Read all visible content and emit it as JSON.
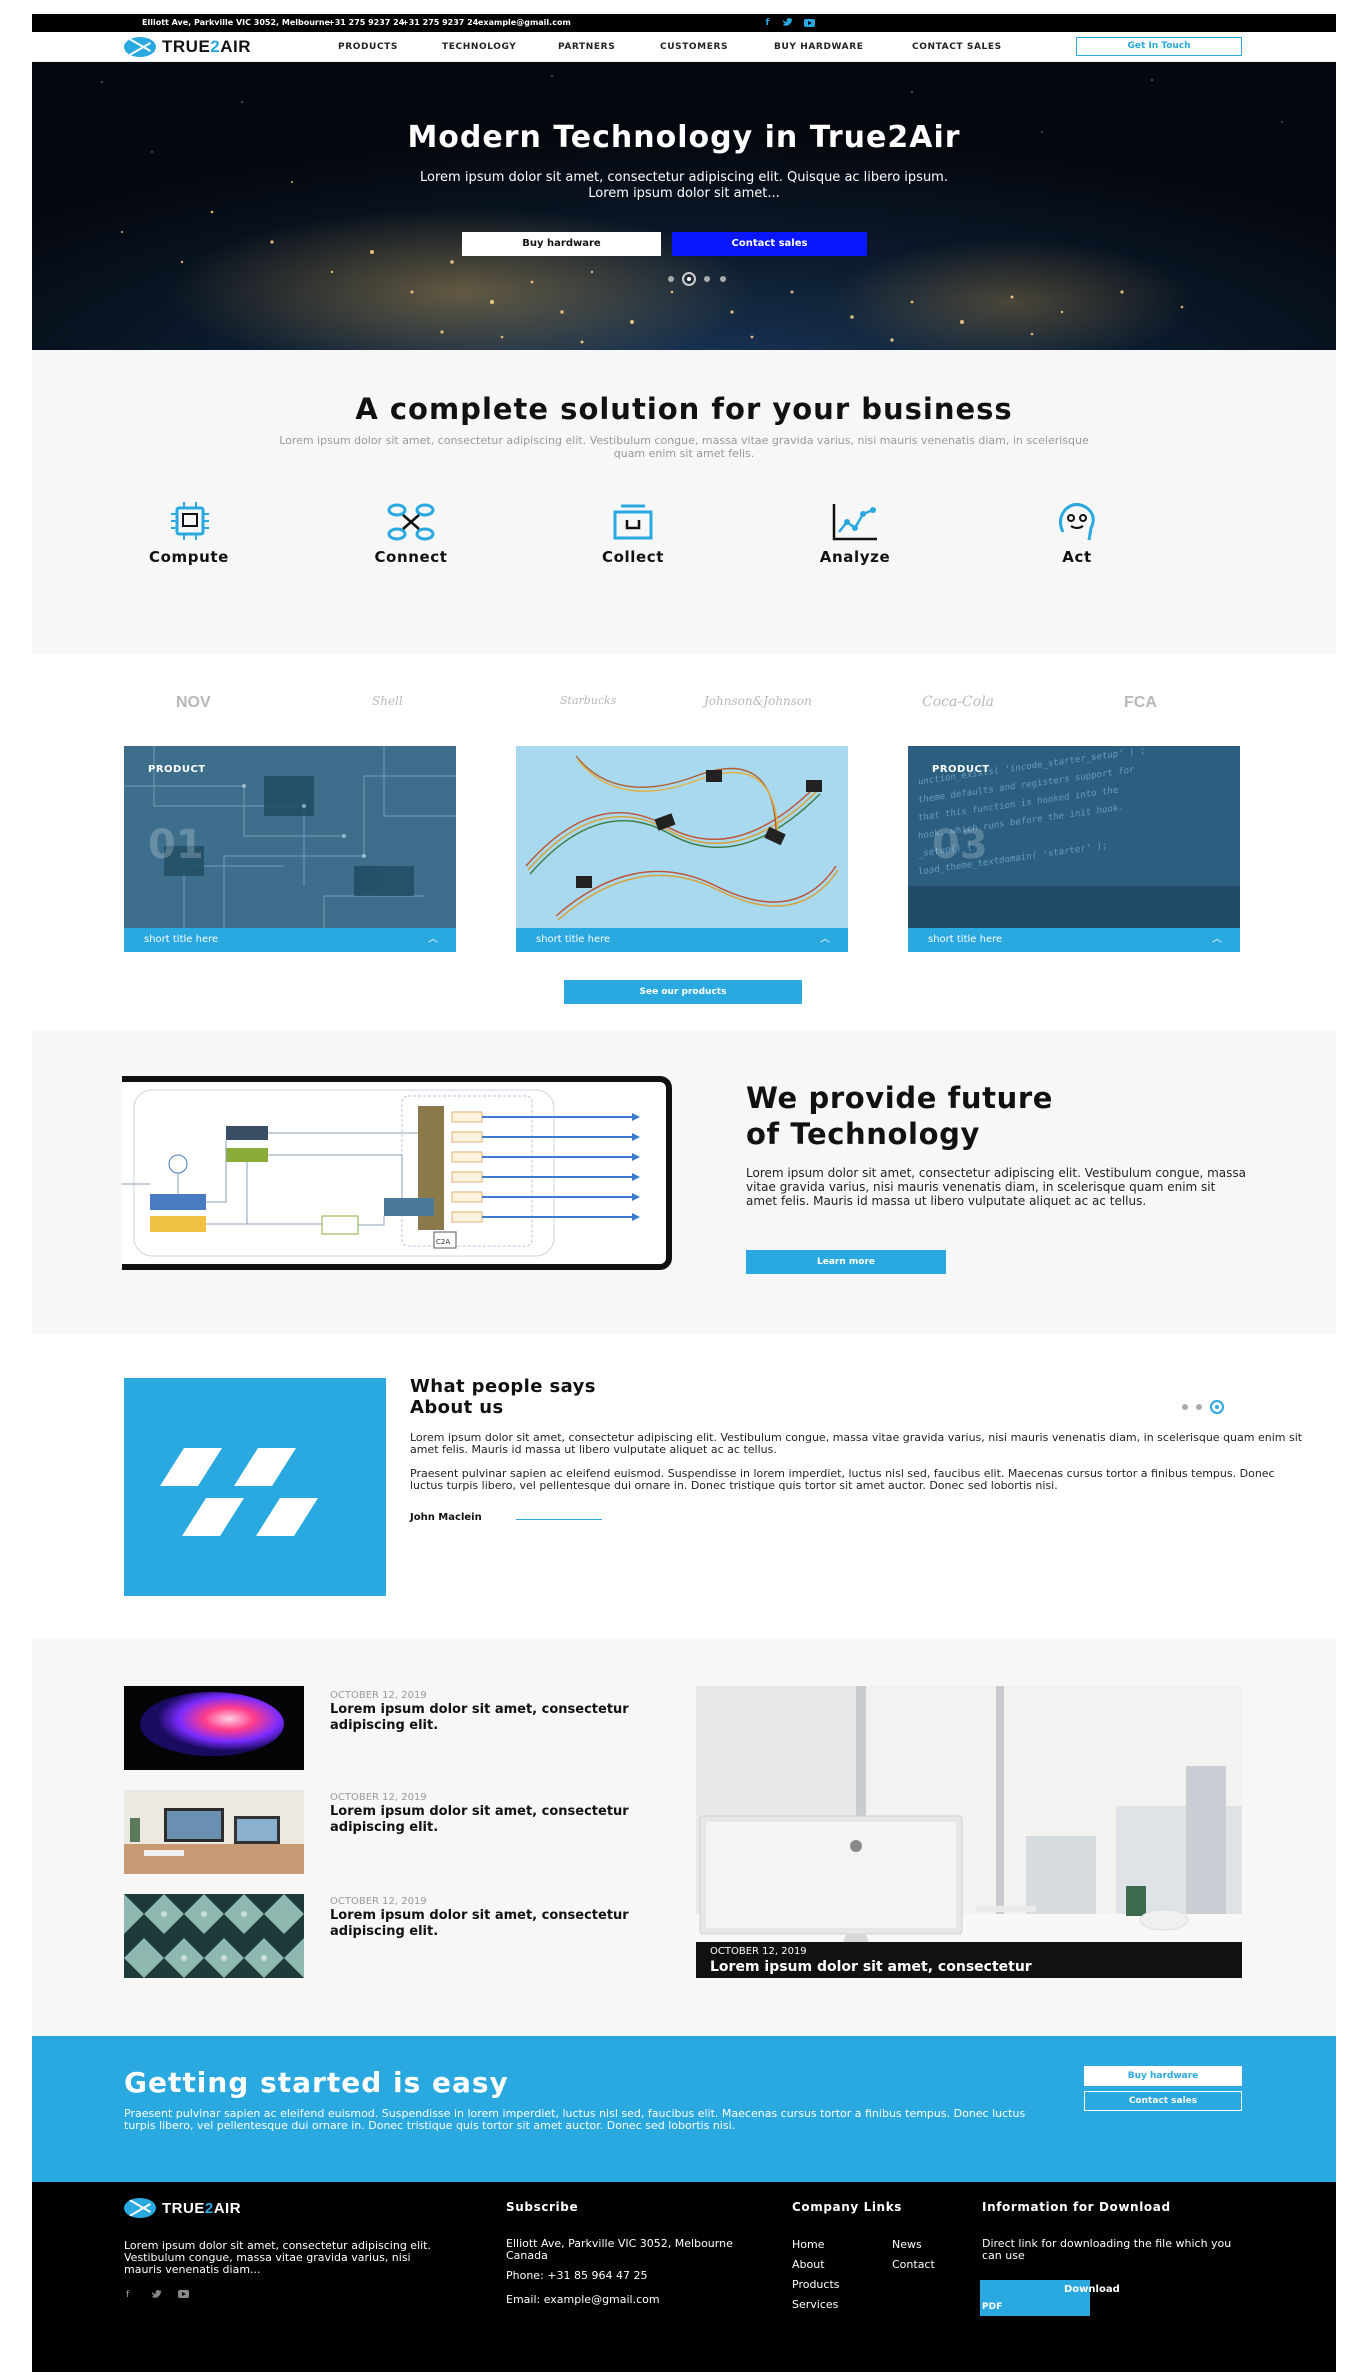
{
  "topbar": {
    "address": "Elliott Ave, Parkville VIC 3052, Melbourne",
    "phone1": "+31 275 9237 24",
    "phone2": "+31 275 9237 24",
    "email": "example@gmail.com",
    "social_icons": [
      "facebook-icon",
      "twitter-icon",
      "youtube-icon"
    ]
  },
  "nav": {
    "logo_prefix": "TRUE",
    "logo_highlight": "2",
    "logo_suffix": "AIR",
    "items": [
      "PRODUCTS",
      "TECHNOLOGY",
      "PARTNERS",
      "CUSTOMERS",
      "BUY HARDWARE",
      "CONTACT SALES"
    ],
    "cta": "Get In Touch"
  },
  "hero": {
    "title": "Modern Technology in True2Air",
    "subtitle_line1": "Lorem ipsum dolor sit amet, consectetur adipiscing elit. Quisque ac libero ipsum.",
    "subtitle_line2": "Lorem ipsum dolor sit amet...",
    "btn_primary": "Buy hardware",
    "btn_secondary": "Contact sales",
    "slides": 5,
    "active_slide": 2
  },
  "solution": {
    "title": "A complete solution for your business",
    "subtitle": "Lorem ipsum dolor sit amet, consectetur adipiscing elit. Vestibulum congue, massa vitae gravida varius, nisi mauris venenatis diam, in scelerisque quam enim sit amet felis.",
    "features": [
      {
        "label": "Compute",
        "icon": "chip-icon"
      },
      {
        "label": "Connect",
        "icon": "connect-icon"
      },
      {
        "label": "Collect",
        "icon": "collect-icon"
      },
      {
        "label": "Analyze",
        "icon": "analyze-chart-icon"
      },
      {
        "label": "Act",
        "icon": "ai-head-icon"
      }
    ]
  },
  "partners": [
    "NOV",
    "Shell",
    "Starbucks",
    "Johnson&Johnson",
    "Coca-Cola",
    "FCA"
  ],
  "products": {
    "cards": [
      {
        "label": "PRODUCT",
        "number": "01",
        "title": "short title here"
      },
      {
        "label": "",
        "number": "",
        "title": "short title here"
      },
      {
        "label": "PRODUCT",
        "number": "03",
        "title": "short title here"
      }
    ],
    "cta": "See our products"
  },
  "future": {
    "title_line1": "We provide future",
    "title_line2": "of Technology",
    "text": "Lorem ipsum dolor sit amet, consectetur adipiscing elit. Vestibulum congue, massa vitae gravida varius, nisi mauris venenatis diam, in scelerisque quam enim sit amet felis. Mauris id massa ut libero vulputate aliquet ac ac tellus.",
    "cta": "Learn more",
    "diagram_labels": [
      "C2A"
    ]
  },
  "testimonial": {
    "title": "What people says About us",
    "para1": "Lorem ipsum dolor sit amet, consectetur adipiscing elit. Vestibulum congue, massa vitae gravida varius, nisi mauris venenatis diam, in scelerisque quam enim sit amet felis. Mauris id massa ut libero vulputate aliquet ac ac tellus.",
    "para2": "Praesent pulvinar sapien ac eleifend euismod. Suspendisse in lorem imperdiet, luctus nisl sed, faucibus elit. Maecenas cursus tortor a finibus tempus. Donec luctus turpis libero, vel pellentesque dui ornare in. Donec tristique quis tortor sit amet auctor. Donec sed lobortis nisi.",
    "author": "John Maclein",
    "slides": 3,
    "active_slide": 2
  },
  "blog": {
    "posts": [
      {
        "date": "OCTOBER 12, 2019",
        "title": "Lorem ipsum dolor sit amet, consectetur adipiscing elit."
      },
      {
        "date": "OCTOBER 12, 2019",
        "title": "Lorem ipsum dolor sit amet, consectetur adipiscing elit."
      },
      {
        "date": "OCTOBER 12, 2019",
        "title": "Lorem ipsum dolor sit amet, consectetur adipiscing elit."
      }
    ],
    "featured": {
      "date": "OCTOBER 12, 2019",
      "title": "Lorem ipsum dolor sit amet, consectetur"
    }
  },
  "cta": {
    "title": "Getting started is easy",
    "text": "Praesent pulvinar sapien ac eleifend euismod. Suspendisse in lorem imperdiet, luctus nisl sed, faucibus elit. Maecenas cursus tortor a finibus tempus. Donec luctus turpis libero, vel pellentesque dui ornare in. Donec tristique quis tortor sit amet auctor. Donec sed lobortis nisi.",
    "btn_primary": "Buy hardware",
    "btn_secondary": "Contact sales"
  },
  "footer": {
    "about": "Lorem ipsum dolor sit amet, consectetur adipiscing elit. Vestibulum congue, massa vitae gravida varius, nisi mauris venenatis diam...",
    "subscribe_heading": "Subscribe",
    "address": "Elliott Ave, Parkville VIC 3052, Melbourne Canada",
    "phone": "Phone: +31 85 964 47 25",
    "email": "Email: example@gmail.com",
    "links_heading": "Company Links",
    "links_col1": [
      "Home",
      "About",
      "Products",
      "Services"
    ],
    "links_col2": [
      "News",
      "Contact"
    ],
    "download_heading": "Information for Download",
    "download_text": "Direct link for downloading the file which you can use",
    "download_button": "Download",
    "download_pdf": "PDF"
  },
  "colors": {
    "accent": "#2aa8e0",
    "hero_secondary_button": "#0a16ff",
    "section_bg": "#f7f7f7",
    "footer_bg": "#000000"
  }
}
